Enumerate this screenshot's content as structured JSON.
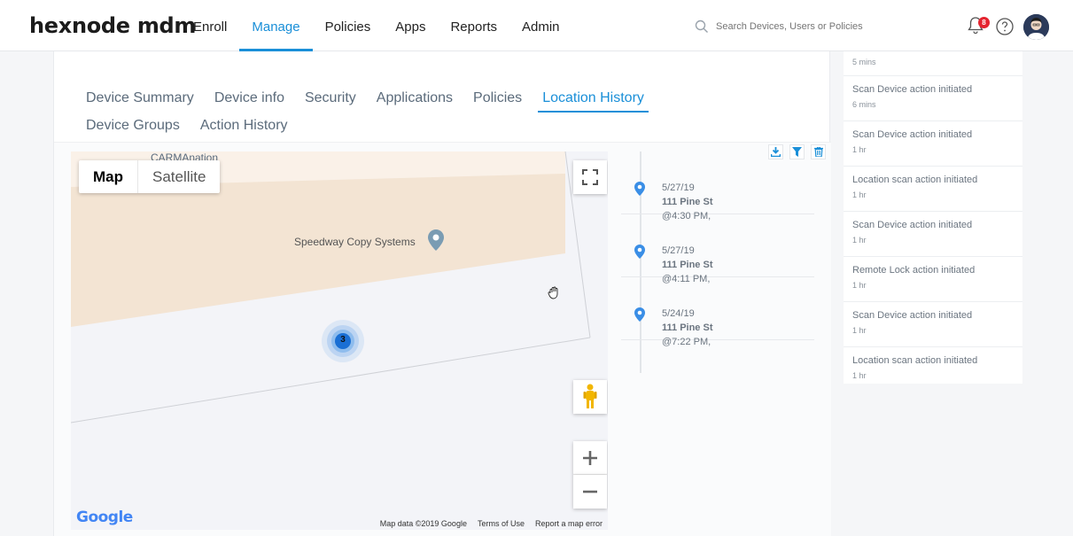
{
  "header": {
    "logo": "hexnode mdm",
    "nav": [
      "Enroll",
      "Manage",
      "Policies",
      "Apps",
      "Reports",
      "Admin"
    ],
    "active_nav": "Manage",
    "search_placeholder": "Search Devices, Users or Policies",
    "notification_count": "8"
  },
  "subtabs": [
    "Device Summary",
    "Device info",
    "Security",
    "Applications",
    "Policies",
    "Location History",
    "Device Groups",
    "Action History"
  ],
  "active_subtab": "Location History",
  "map": {
    "type_tabs": [
      "Map",
      "Satellite"
    ],
    "active_type": "Map",
    "place_label": "Speedway Copy Systems",
    "top_label": "CARMAnation",
    "cluster_count": "3",
    "footer": [
      "Map data ©2019 Google",
      "Terms of Use",
      "Report a map error"
    ],
    "brand": "Google"
  },
  "timeline": [
    {
      "date": "5/27/19",
      "address": "111 Pine St",
      "time": "@4:30 PM,"
    },
    {
      "date": "5/27/19",
      "address": "111 Pine St",
      "time": "@4:11 PM,"
    },
    {
      "date": "5/24/19",
      "address": "111 Pine St",
      "time": "@7:22 PM,"
    }
  ],
  "activity": [
    {
      "title": "",
      "time": "5 mins"
    },
    {
      "title": "Scan Device action initiated",
      "time": "6 mins"
    },
    {
      "title": "Scan Device action initiated",
      "time": "1 hr"
    },
    {
      "title": "Location scan action initiated",
      "time": "1 hr"
    },
    {
      "title": "Scan Device action initiated",
      "time": "1 hr"
    },
    {
      "title": "Remote Lock action initiated",
      "time": "1 hr"
    },
    {
      "title": "Scan Device action initiated",
      "time": "1 hr"
    },
    {
      "title": "Location scan action initiated",
      "time": "1 hr"
    }
  ],
  "colors": {
    "accent": "#1a8fd8",
    "badge": "#e4242f",
    "pin": "#3a8ee6"
  },
  "icons": [
    "search-icon",
    "bell-icon",
    "help-icon",
    "download-icon",
    "filter-icon",
    "trash-icon",
    "fullscreen-icon",
    "pegman-icon",
    "zoom-in-icon",
    "zoom-out-icon",
    "map-pin-icon",
    "hand-cursor-icon"
  ]
}
